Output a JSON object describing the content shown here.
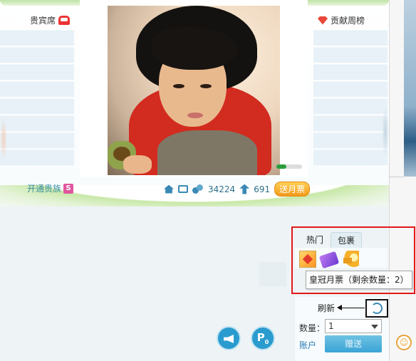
{
  "vip_seats": {
    "title": "贵宾席",
    "slots": 8
  },
  "contribution_rank": {
    "title": "贡献周榜",
    "slots": 8
  },
  "room_info": {
    "open_noble": "开通贵族",
    "noble_badge": "S",
    "fans_count": "34224",
    "tickets_count": "691",
    "send_ticket_button": "送月票"
  },
  "gift_panel": {
    "tabs": [
      {
        "label": "热门",
        "active": false
      },
      {
        "label": "包裹",
        "active": true
      }
    ],
    "items": [
      "crown-ticket",
      "purple-ticket",
      "horn"
    ],
    "tooltip": "皇冠月票（剩余数量：2）",
    "refresh_label": "刷新",
    "quantity_label": "数量：",
    "quantity_value": "1",
    "account_link": "账户",
    "send_button": "赠送"
  },
  "bottom_buttons": {
    "horn": "horn-icon",
    "parking_label": "P",
    "parking_count": "0"
  },
  "chat_emoji": "☺",
  "colors": {
    "accent": "#2a9bcf",
    "highlight_box": "#e21818",
    "ticket_button": "#f29a19"
  }
}
